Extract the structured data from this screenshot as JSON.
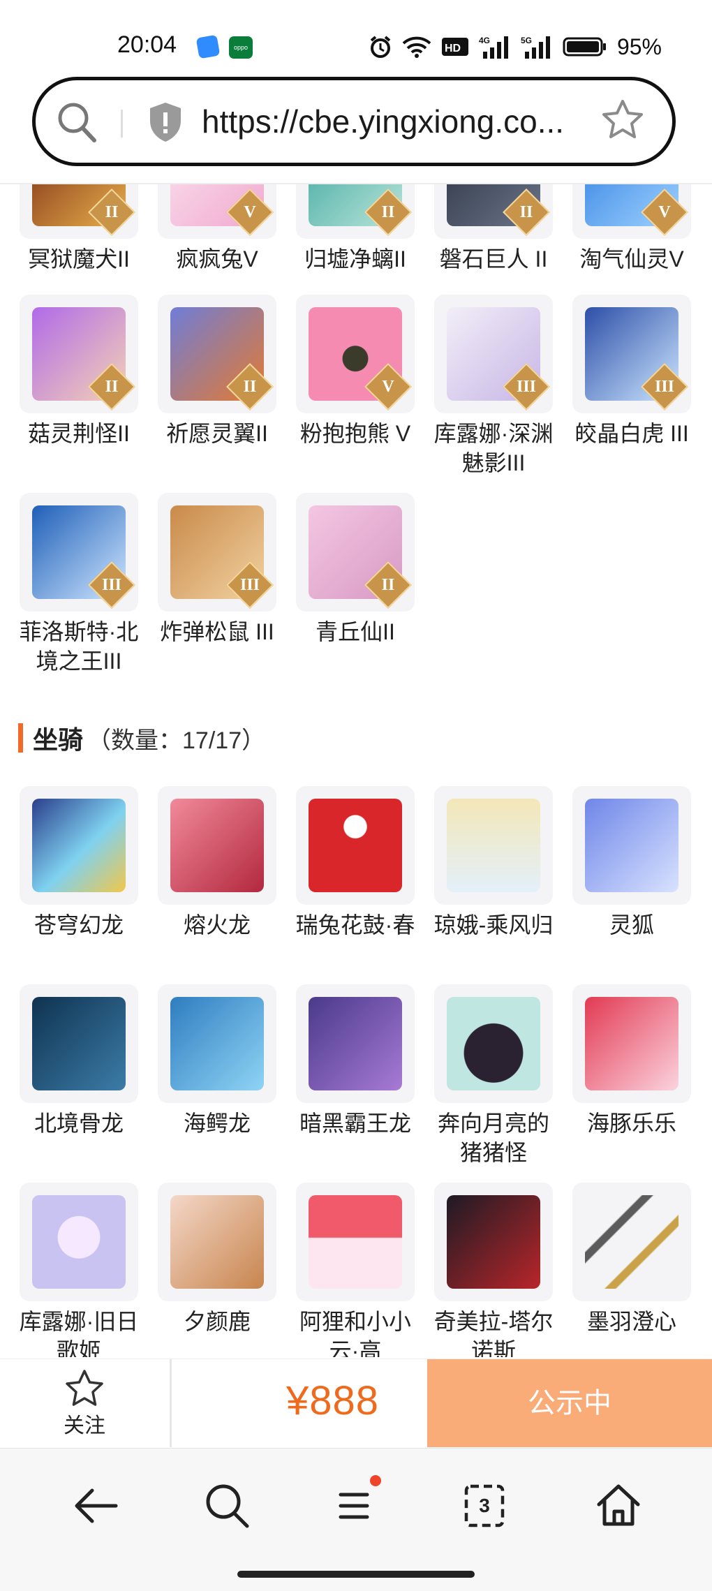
{
  "status_bar": {
    "time": "20:04",
    "battery": "95%",
    "icons": [
      "alarm-icon",
      "wifi-icon",
      "hd-icon",
      "signal-4g-icon",
      "signal-5g-icon",
      "battery-icon"
    ]
  },
  "browser": {
    "url": "https://cbe.yingxiong.co..."
  },
  "pets_rows": [
    [
      {
        "name": "冥狱魔犬II",
        "rank": "II"
      },
      {
        "name": "疯疯兔V",
        "rank": "V"
      },
      {
        "name": "归墟净螭II",
        "rank": "II"
      },
      {
        "name": "磐石巨人 II",
        "rank": "II"
      },
      {
        "name": "淘气仙灵V",
        "rank": "V"
      }
    ],
    [
      {
        "name": "菇灵荆怪II",
        "rank": "II"
      },
      {
        "name": "祈愿灵翼II",
        "rank": "II"
      },
      {
        "name": "粉抱抱熊 V",
        "rank": "V"
      },
      {
        "name": "库露娜·深渊魅影III",
        "rank": "III"
      },
      {
        "name": "皎晶白虎 III",
        "rank": "III"
      }
    ],
    [
      {
        "name": "菲洛斯特·北境之王III",
        "rank": "III"
      },
      {
        "name": "炸弹松鼠 III",
        "rank": "III"
      },
      {
        "name": "青丘仙II",
        "rank": "II"
      }
    ]
  ],
  "mounts_section": {
    "title": "坐骑",
    "count": "（数量：17/17）"
  },
  "mounts_rows": [
    [
      {
        "name": "苍穹幻龙"
      },
      {
        "name": "熔火龙"
      },
      {
        "name": "瑞兔花鼓·春"
      },
      {
        "name": "琼娥-乘风归"
      },
      {
        "name": "灵狐"
      }
    ],
    [
      {
        "name": "北境骨龙"
      },
      {
        "name": "海鳄龙"
      },
      {
        "name": "暗黑霸王龙"
      },
      {
        "name": "奔向月亮的猪猪怪"
      },
      {
        "name": "海豚乐乐"
      }
    ],
    [
      {
        "name": "库露娜·旧日歌姬"
      },
      {
        "name": "夕颜鹿"
      },
      {
        "name": "阿狸和小小云·高"
      },
      {
        "name": "奇美拉-塔尔诺斯"
      },
      {
        "name": "墨羽澄心"
      }
    ]
  ],
  "action_bar": {
    "follow_label": "关注",
    "price": "¥888",
    "status_label": "公示中"
  },
  "nav": {
    "tab_count": "3"
  }
}
